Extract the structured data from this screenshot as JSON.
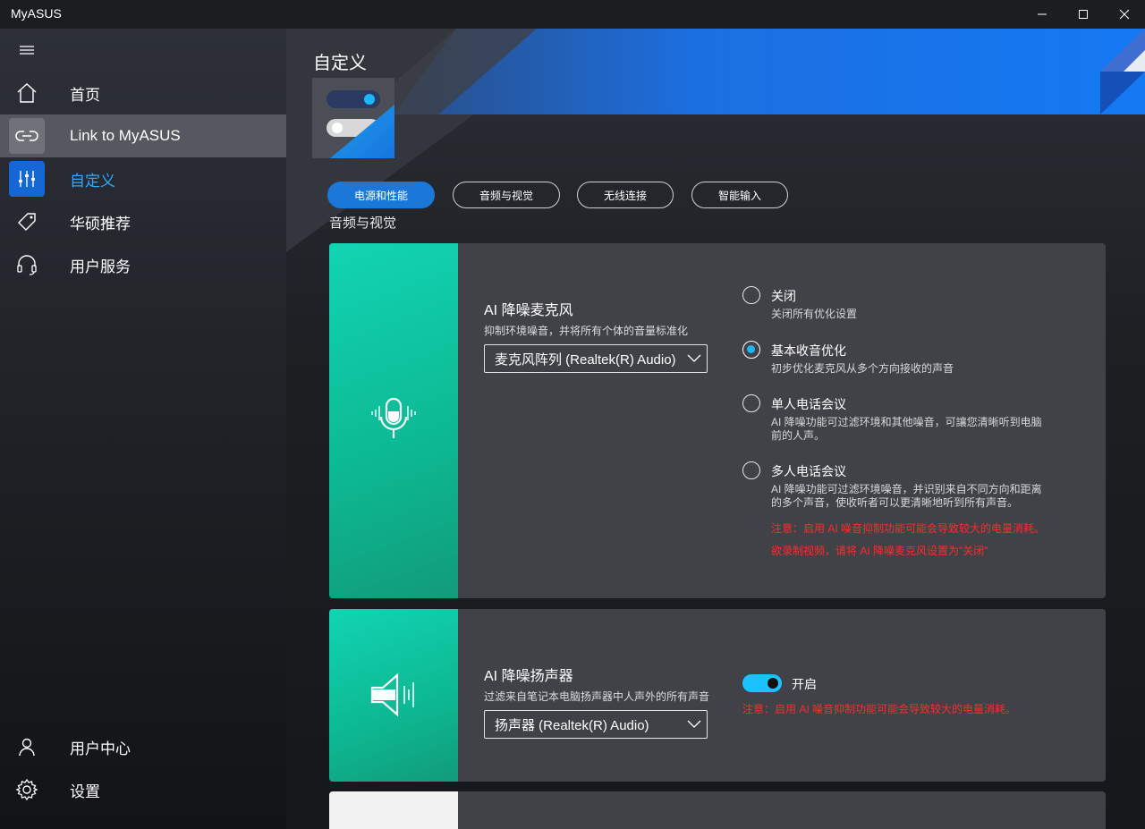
{
  "window": {
    "title": "MyASUS",
    "controls": {
      "minimize": "minimize-icon",
      "maximize": "maximize-icon",
      "close": "close-icon"
    }
  },
  "sidebar": {
    "menu_icon": "hamburger-icon",
    "items": [
      {
        "label": "首页",
        "icon": "home-icon"
      },
      {
        "label": "Link to MyASUS",
        "icon": "link-icon"
      },
      {
        "label": "自定义",
        "icon": "sliders-icon"
      },
      {
        "label": "华硕推荐",
        "icon": "tag-icon"
      },
      {
        "label": "用户服务",
        "icon": "headset-icon"
      }
    ],
    "bottom_items": [
      {
        "label": "用户中心",
        "icon": "user-icon"
      },
      {
        "label": "设置",
        "icon": "gear-icon"
      }
    ]
  },
  "main": {
    "page_title": "自定义",
    "tabs": [
      "电源和性能",
      "音频与视觉",
      "无线连接",
      "智能输入"
    ],
    "active_tab": 0,
    "section_heading": "音频与视觉",
    "mic_card": {
      "icon": "microphone-icon",
      "title": "AI 降噪麦克风",
      "description": "抑制环境噪音，并将所有个体的音量标准化",
      "select_value": "麦克风阵列 (Realtek(R) Audio)",
      "options": [
        {
          "label": "关闭",
          "desc": "关闭所有优化设置",
          "checked": false
        },
        {
          "label": "基本收音优化",
          "desc": "初步优化麦克风从多个方向接收的声音",
          "checked": true
        },
        {
          "label": "单人电话会议",
          "desc": "AI 降噪功能可过滤环境和其他噪音，可讓您清晰听到电脑前的人声。",
          "checked": false
        },
        {
          "label": "多人电话会议",
          "desc": "AI 降噪功能可过滤环境噪音，并识别来自不同方向和距离的多个声音，使收听者可以更清晰地听到所有声音。",
          "checked": false
        }
      ],
      "warnings": [
        "注意：启用 AI 噪音抑制功能可能会导致较大的电量消耗。",
        "欲录制视频，请将 AI 降噪麦克风设置为\"关闭\""
      ]
    },
    "speaker_card": {
      "icon": "speaker-icon",
      "title": "AI 降噪扬声器",
      "description": "过滤来自笔记本电脑扬声器中人声外的所有声音",
      "select_value": "扬声器 (Realtek(R) Audio)",
      "toggle_label": "开启",
      "toggle_on": true,
      "warning": "注意：启用 AI 噪音抑制功能可能会导致较大的电量消耗。"
    }
  }
}
